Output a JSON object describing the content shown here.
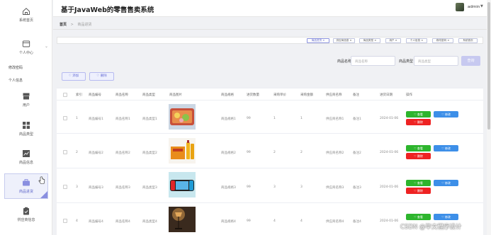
{
  "app": {
    "title": "基于JavaWeb的零售售卖系统"
  },
  "user": {
    "name": "admin",
    "caret": "▼"
  },
  "breadcrumb": {
    "home": "首页",
    "sep": ">",
    "current": "商品进货"
  },
  "sidebar": {
    "home": "系统首页",
    "personal_center": "个人中心",
    "change_password": "修改密码",
    "personal_info": "个人信息",
    "users": "用户",
    "category": "商品类型",
    "goods_info": "商品信息",
    "purchase": "商品进货",
    "supplier": "供应商信息",
    "collapse_arrow": "⌄"
  },
  "filter_chips": [
    "商品进货 ×",
    "供应商信息 ×",
    "商品类型 ×",
    "用户 ×",
    "个人信息 ×",
    "修改密码 ×",
    "系统首页"
  ],
  "search": {
    "name_label": "商品名称",
    "name_placeholder": "商品名称",
    "type_label": "商品类型",
    "type_placeholder": "商品类型",
    "query_label": "查询"
  },
  "actions": {
    "add": "♡ 添加",
    "delete": "♡ 删除"
  },
  "table": {
    "headers": [
      "索引",
      "商品编号",
      "商品名称",
      "商品类型",
      "商品图片",
      "商品规格",
      "进货数量",
      "采购单价",
      "采购金额",
      "供应商名称",
      "备注",
      "进货日期",
      "操作"
    ],
    "rows": [
      {
        "idx": "1",
        "code": "商品编号1",
        "name": "商品名称1",
        "type": "商品类型1",
        "spec": "商品规格1",
        "qty": "99",
        "price": "1",
        "amount": "1",
        "supplier": "供应商名称1",
        "note": "备注1",
        "date": "2024-01-06"
      },
      {
        "idx": "2",
        "code": "商品编号2",
        "name": "商品名称2",
        "type": "商品类型2",
        "spec": "商品规格2",
        "qty": "99",
        "price": "2",
        "amount": "2",
        "supplier": "供应商名称2",
        "note": "备注2",
        "date": "2024-01-06"
      },
      {
        "idx": "3",
        "code": "商品编号3",
        "name": "商品名称3",
        "type": "商品类型3",
        "spec": "商品规格3",
        "qty": "99",
        "price": "3",
        "amount": "3",
        "supplier": "供应商名称3",
        "note": "备注3",
        "date": "2024-01-06"
      },
      {
        "idx": "4",
        "code": "商品编号4",
        "name": "商品名称4",
        "type": "商品类型4",
        "spec": "商品规格4",
        "qty": "99",
        "price": "4",
        "amount": "4",
        "supplier": "供应商名称4",
        "note": "备注4",
        "date": "2024-01-06"
      }
    ],
    "row_buttons": {
      "view": "♡ 查看",
      "edit": "♡ 修改",
      "delete": "♡ 删除"
    }
  },
  "watermark": "CSDN @毕文程序设计"
}
